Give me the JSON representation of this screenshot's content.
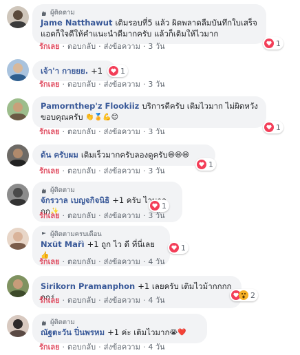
{
  "comments": [
    {
      "badge": "ผู้ติดตาม",
      "author": "Jame Natthawut",
      "text": "เติมรอบที่5 แล้ว ผิดพลาดลืมบันทึกใบเสร็จ แอดก็ใจดีให้คำแนะนำดีมากครับ แล้วก็เติมให้ไวมาก",
      "like_label": "รักเลย",
      "reply_label": "ตอบกลับ",
      "message_label": "ส่งข้อความ",
      "time": "3 วัน",
      "reaction_count": "1",
      "avatar_color": "#5b4a3c"
    },
    {
      "badge": "",
      "author": "เจ้า'า กายยย.",
      "text": "+1",
      "like_label": "รักเลย",
      "reply_label": "ตอบกลับ",
      "message_label": "ส่งข้อความ",
      "time": "3 วัน",
      "reaction_count": "1",
      "avatar_color": "#6b8fb8"
    },
    {
      "badge": "",
      "author": "Pamornthep'z Flookiiz",
      "text": "บริการดีครับ เติมไวมาก ไม่ผิดหวัง ขอบคุณครับ",
      "like_label": "รักเลย",
      "reply_label": "ตอบกลับ",
      "message_label": "ส่งข้อความ",
      "time": "3 วัน",
      "reaction_count": "1",
      "avatar_color": "#8a6a4a"
    },
    {
      "badge": "",
      "author": "ต้น ครับผม",
      "text": "เติมเร็วมากครับลองดูครับ",
      "like_label": "รักเลย",
      "reply_label": "ตอบกลับ",
      "message_label": "ส่งข้อความ",
      "time": "3 วัน",
      "reaction_count": "1",
      "avatar_color": "#3d3b3a"
    },
    {
      "badge": "ผู้ติดตาม",
      "author": "จักรวาล เบญจกิจนิธิ",
      "text": "+1 ครับ ไวมากกก",
      "like_label": "รักเลย",
      "reply_label": "ตอบกลับ",
      "message_label": "ส่งข้อความ",
      "time": "3 วัน",
      "reaction_count": "1",
      "avatar_color": "#4a4a4a"
    },
    {
      "badge": "ผู้ติดตามครบเดือน",
      "author": "Nxüt Mařì",
      "text": "+1 ถูก ไว ดี ที่นี่เลย",
      "like_label": "รักเลย",
      "reply_label": "ตอบกลับ",
      "message_label": "ส่งข้อความ",
      "time": "4 วัน",
      "reaction_count": "1",
      "avatar_color": "#c9a58e"
    },
    {
      "badge": "",
      "author": "Sirikorn Pramanphon",
      "text": "+1 เลยครับ เติมไวม้ากกกกกก",
      "like_label": "รักเลย",
      "reply_label": "ตอบกลับ",
      "message_label": "ส่งข้อความ",
      "time": "4 วัน",
      "reaction_count": "2",
      "avatar_color": "#55663a"
    },
    {
      "badge": "ผู้ติดตาม",
      "author": "ณัฐตะวัน ปิ่นพรหม",
      "text": "+1 ค่ะ เติมไวมาก",
      "like_label": "รักเลย",
      "reply_label": "ตอบกลับ",
      "message_label": "ส่งข้อความ",
      "time": "4 วัน",
      "reaction_count": "1",
      "avatar_color": "#2e2a2a"
    }
  ],
  "colors": {
    "author": "#385898",
    "like": "#e04c60",
    "bubble": "#f2f3f5",
    "heart": "#f33e58"
  }
}
